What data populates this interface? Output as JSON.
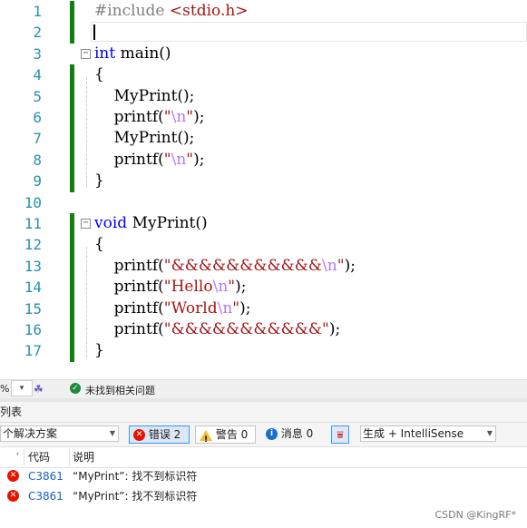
{
  "editor": {
    "lines": [
      {
        "n": "1",
        "bar": true,
        "fold": "",
        "tokens": [
          {
            "t": "#include ",
            "c": "pp"
          },
          {
            "t": "<stdio.h>",
            "c": "inc"
          }
        ]
      },
      {
        "n": "2",
        "bar": true,
        "caret": true,
        "fold": "",
        "tokens": []
      },
      {
        "n": "3",
        "bar": false,
        "fold": "minus",
        "tokens": [
          {
            "t": "int",
            "c": "kw"
          },
          {
            "t": " main()",
            "c": ""
          }
        ]
      },
      {
        "n": "4",
        "bar": true,
        "fold": "",
        "tokens": [
          {
            "t": "{",
            "c": ""
          }
        ]
      },
      {
        "n": "5",
        "bar": true,
        "fold": "",
        "tokens": [
          {
            "t": "    MyPrint();",
            "c": ""
          }
        ]
      },
      {
        "n": "6",
        "bar": true,
        "fold": "",
        "tokens": [
          {
            "t": "    printf(",
            "c": ""
          },
          {
            "t": "\"",
            "c": "str"
          },
          {
            "t": "\\n",
            "c": "esc"
          },
          {
            "t": "\"",
            "c": "str"
          },
          {
            "t": ");",
            "c": ""
          }
        ]
      },
      {
        "n": "7",
        "bar": true,
        "fold": "",
        "tokens": [
          {
            "t": "    MyPrint();",
            "c": ""
          }
        ]
      },
      {
        "n": "8",
        "bar": true,
        "fold": "",
        "tokens": [
          {
            "t": "    printf(",
            "c": ""
          },
          {
            "t": "\"",
            "c": "str"
          },
          {
            "t": "\\n",
            "c": "esc"
          },
          {
            "t": "\"",
            "c": "str"
          },
          {
            "t": ");",
            "c": ""
          }
        ]
      },
      {
        "n": "9",
        "bar": true,
        "fold": "",
        "tokens": [
          {
            "t": "}",
            "c": ""
          }
        ]
      },
      {
        "n": "10",
        "bar": false,
        "fold": "",
        "tokens": []
      },
      {
        "n": "11",
        "bar": true,
        "fold": "minus",
        "tokens": [
          {
            "t": "void",
            "c": "kw"
          },
          {
            "t": " MyPrint()",
            "c": ""
          }
        ]
      },
      {
        "n": "12",
        "bar": true,
        "fold": "",
        "tokens": [
          {
            "t": "{",
            "c": ""
          }
        ]
      },
      {
        "n": "13",
        "bar": true,
        "fold": "",
        "tokens": [
          {
            "t": "    printf(",
            "c": ""
          },
          {
            "t": "\"&&&&&&&&&&&",
            "c": "str"
          },
          {
            "t": "\\n",
            "c": "esc"
          },
          {
            "t": "\"",
            "c": "str"
          },
          {
            "t": ");",
            "c": ""
          }
        ]
      },
      {
        "n": "14",
        "bar": true,
        "fold": "",
        "tokens": [
          {
            "t": "    printf(",
            "c": ""
          },
          {
            "t": "\"Hello",
            "c": "str"
          },
          {
            "t": "\\n",
            "c": "esc"
          },
          {
            "t": "\"",
            "c": "str"
          },
          {
            "t": ");",
            "c": ""
          }
        ]
      },
      {
        "n": "15",
        "bar": true,
        "fold": "",
        "tokens": [
          {
            "t": "    printf(",
            "c": ""
          },
          {
            "t": "\"World",
            "c": "str"
          },
          {
            "t": "\\n",
            "c": "esc"
          },
          {
            "t": "\"",
            "c": "str"
          },
          {
            "t": ");",
            "c": ""
          }
        ]
      },
      {
        "n": "16",
        "bar": true,
        "fold": "",
        "tokens": [
          {
            "t": "    printf(",
            "c": ""
          },
          {
            "t": "\"&&&&&&&&&&&\"",
            "c": "str"
          },
          {
            "t": ");",
            "c": ""
          }
        ]
      },
      {
        "n": "17",
        "bar": true,
        "fold": "",
        "tokens": [
          {
            "t": "}",
            "c": ""
          }
        ]
      }
    ]
  },
  "status": {
    "zoom": "%",
    "zoom_arrow": "▾",
    "issues_text": "未找到相关问题"
  },
  "error_list": {
    "title": "列表",
    "scope": "个解决方案",
    "errors_label": "错误 2",
    "warnings_label": "警告 0",
    "messages_label": "消息 0",
    "source_filter": "生成 + IntelliSense",
    "columns": {
      "code": "代码",
      "description": "说明"
    },
    "rows": [
      {
        "code": "C3861",
        "description": "“MyPrint”: 找不到标识符"
      },
      {
        "code": "C3861",
        "description": "“MyPrint”: 找不到标识符"
      }
    ]
  },
  "watermark": "CSDN @KingRF*",
  "colors": {
    "change_bar": "#108010",
    "keyword": "#0000ff",
    "string": "#a31515",
    "escape": "#b776fb",
    "line_number": "#2b91af"
  }
}
